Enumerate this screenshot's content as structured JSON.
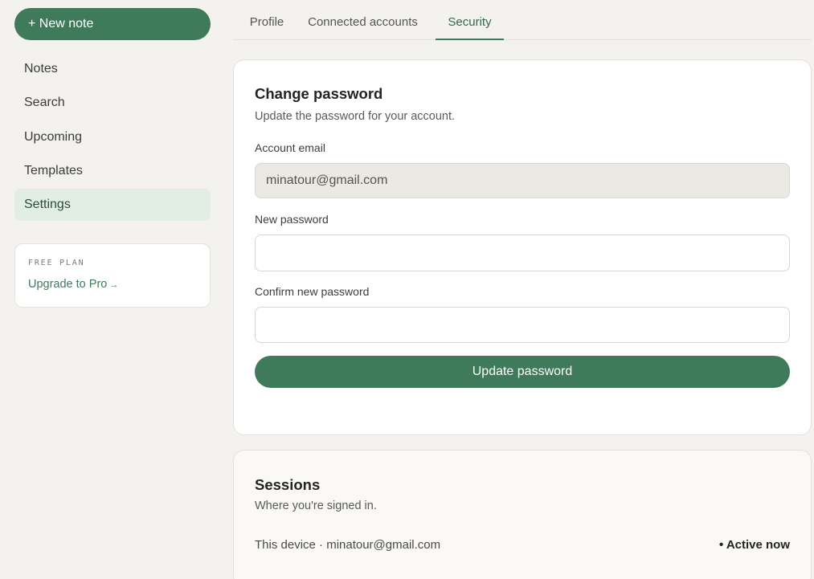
{
  "sidebar": {
    "new_note_label": "+ New note",
    "items": [
      {
        "label": "Notes"
      },
      {
        "label": "Search"
      },
      {
        "label": "Upcoming"
      },
      {
        "label": "Templates"
      },
      {
        "label": "Settings",
        "active": true
      }
    ],
    "plan": {
      "label": "FREE PLAN",
      "upgrade_label": "Upgrade to Pro",
      "upgrade_arrow": "→"
    }
  },
  "tabs": [
    {
      "label": "Profile"
    },
    {
      "label": "Connected accounts"
    },
    {
      "label": "Security",
      "active": true
    }
  ],
  "change_password": {
    "title": "Change password",
    "subtitle": "Update the password for your account.",
    "email_label": "Account email",
    "email_value": "minatour@gmail.com",
    "new_password_label": "New password",
    "new_password_value": "",
    "confirm_label": "Confirm new password",
    "confirm_value": "",
    "submit_label": "Update password"
  },
  "sessions": {
    "title": "Sessions",
    "subtitle": "Where you're signed in.",
    "device_text": "This device · minatour@gmail.com",
    "status_text": "• Active now"
  },
  "colors": {
    "accent": "#3f7a5a",
    "active_nav_bg": "#e2ede4",
    "page_bg": "#f3f2ee"
  },
  "icons": {
    "upgrade_arrow": "arrow-right-icon"
  }
}
